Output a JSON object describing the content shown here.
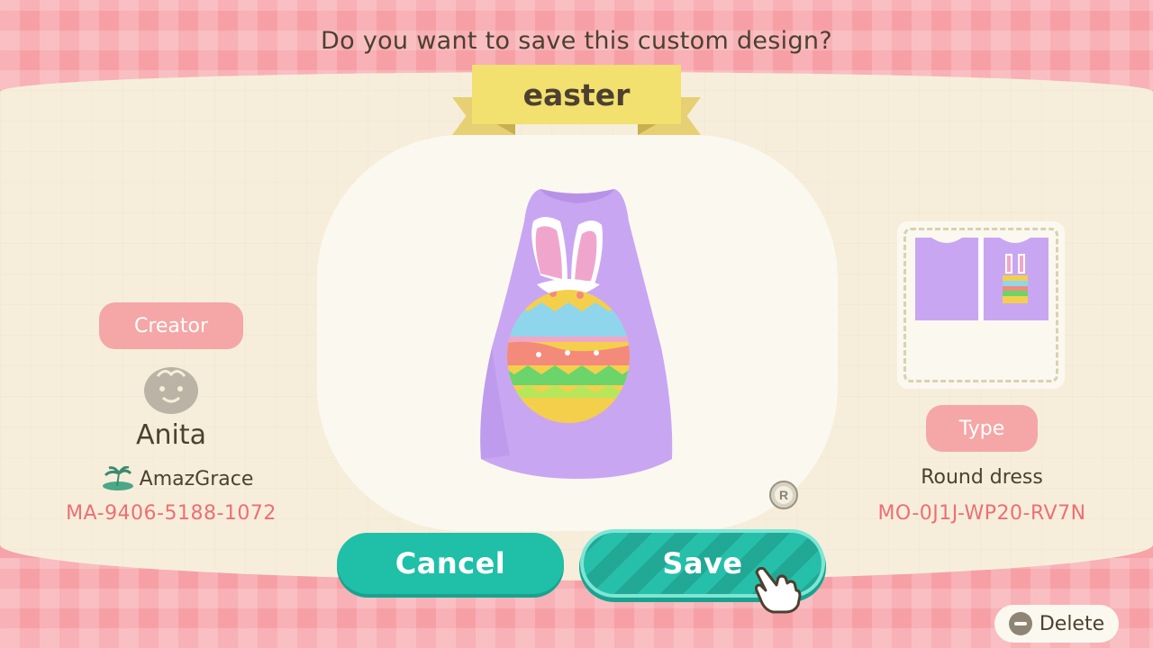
{
  "dialog": {
    "question": "Do you want to save this custom design?",
    "design_name": "easter"
  },
  "creator": {
    "label": "Creator",
    "avatar_icon": "villager-face-icon",
    "name": "Anita",
    "island_icon": "island-icon",
    "island": "AmazGrace",
    "code": "MA-9406-5188-1072"
  },
  "design": {
    "preview_icon": "round-dress-bunny-egg",
    "type_label": "Type",
    "type": "Round dress",
    "code": "MO-0J1J-WP20-RV7N",
    "rotate_icon": "r-stick-rotate-icon"
  },
  "buttons": {
    "cancel": "Cancel",
    "save": "Save",
    "delete": "Delete",
    "delete_icon": "minus-button-icon"
  },
  "colors": {
    "teal": "#1fbfa8",
    "pink": "#f4a7a6",
    "code_red": "#ef6e72",
    "ribbon": "#f2e06f",
    "dress": "#c9a6f2"
  }
}
